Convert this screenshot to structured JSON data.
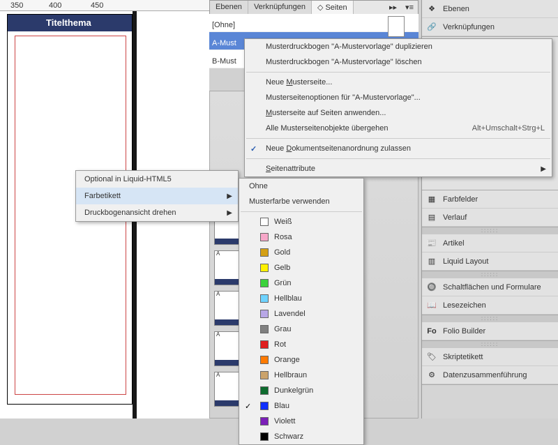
{
  "canvas": {
    "title": "Titelthema",
    "ruler": {
      "r350": "350",
      "r400": "400",
      "r450": "450"
    }
  },
  "tabs": {
    "ebenen": "Ebenen",
    "verknuepfungen": "Verknüpfungen",
    "seiten": "Seiten"
  },
  "masters": {
    "none": "[Ohne]",
    "a": "A-Mustervorlage",
    "b": "B-Mustervorlage"
  },
  "dock": {
    "ebenen": "Ebenen",
    "verknuepfungen": "Verknüpfungen",
    "farbfelder": "Farbfelder",
    "verlauf": "Verlauf",
    "artikel": "Artikel",
    "liquid": "Liquid Layout",
    "schalt": "Schaltflächen und Formulare",
    "lesezeichen": "Lesezeichen",
    "folio": "Folio Builder",
    "skript": "Skriptetikett",
    "daten": "Datenzusammenführung"
  },
  "ctx": {
    "dup": "Musterdruckbogen \"A-Mustervorlage\" duplizieren",
    "del": "Musterdruckbogen \"A-Mustervorlage\" löschen",
    "new": "Neue Musterseite...",
    "opts": "Musterseitenoptionen für \"A-Mustervorlage\"...",
    "apply": "Musterseite auf Seiten anwenden...",
    "override": "Alle Musterseitenobjekte übergehen",
    "override_sc": "Alt+Umschalt+Strg+L",
    "allow": "Neue Dokumentseitenanordnung zulassen",
    "attrs": "Seitenattribute"
  },
  "sub_left": {
    "optional": "Optional in Liquid-HTML5",
    "farbetikett": "Farbetikett",
    "drehen": "Druckbogenansicht drehen"
  },
  "color_menu": {
    "ohne": "Ohne",
    "verwenden": "Musterfarbe verwenden",
    "items": [
      {
        "label": "Weiß",
        "hex": "#ffffff"
      },
      {
        "label": "Rosa",
        "hex": "#f7a7c9"
      },
      {
        "label": "Gold",
        "hex": "#d4a015"
      },
      {
        "label": "Gelb",
        "hex": "#fff100"
      },
      {
        "label": "Grün",
        "hex": "#3bd23b"
      },
      {
        "label": "Hellblau",
        "hex": "#6fd3ff"
      },
      {
        "label": "Lavendel",
        "hex": "#b8a7e6"
      },
      {
        "label": "Grau",
        "hex": "#808080"
      },
      {
        "label": "Rot",
        "hex": "#e02020"
      },
      {
        "label": "Orange",
        "hex": "#ff7a00"
      },
      {
        "label": "Hellbraun",
        "hex": "#cba36b"
      },
      {
        "label": "Dunkelgrün",
        "hex": "#0e6b2e"
      },
      {
        "label": "Blau",
        "hex": "#1030ff"
      },
      {
        "label": "Violett",
        "hex": "#7b1fb8"
      },
      {
        "label": "Schwarz",
        "hex": "#000000"
      }
    ],
    "selected": "Blau"
  }
}
